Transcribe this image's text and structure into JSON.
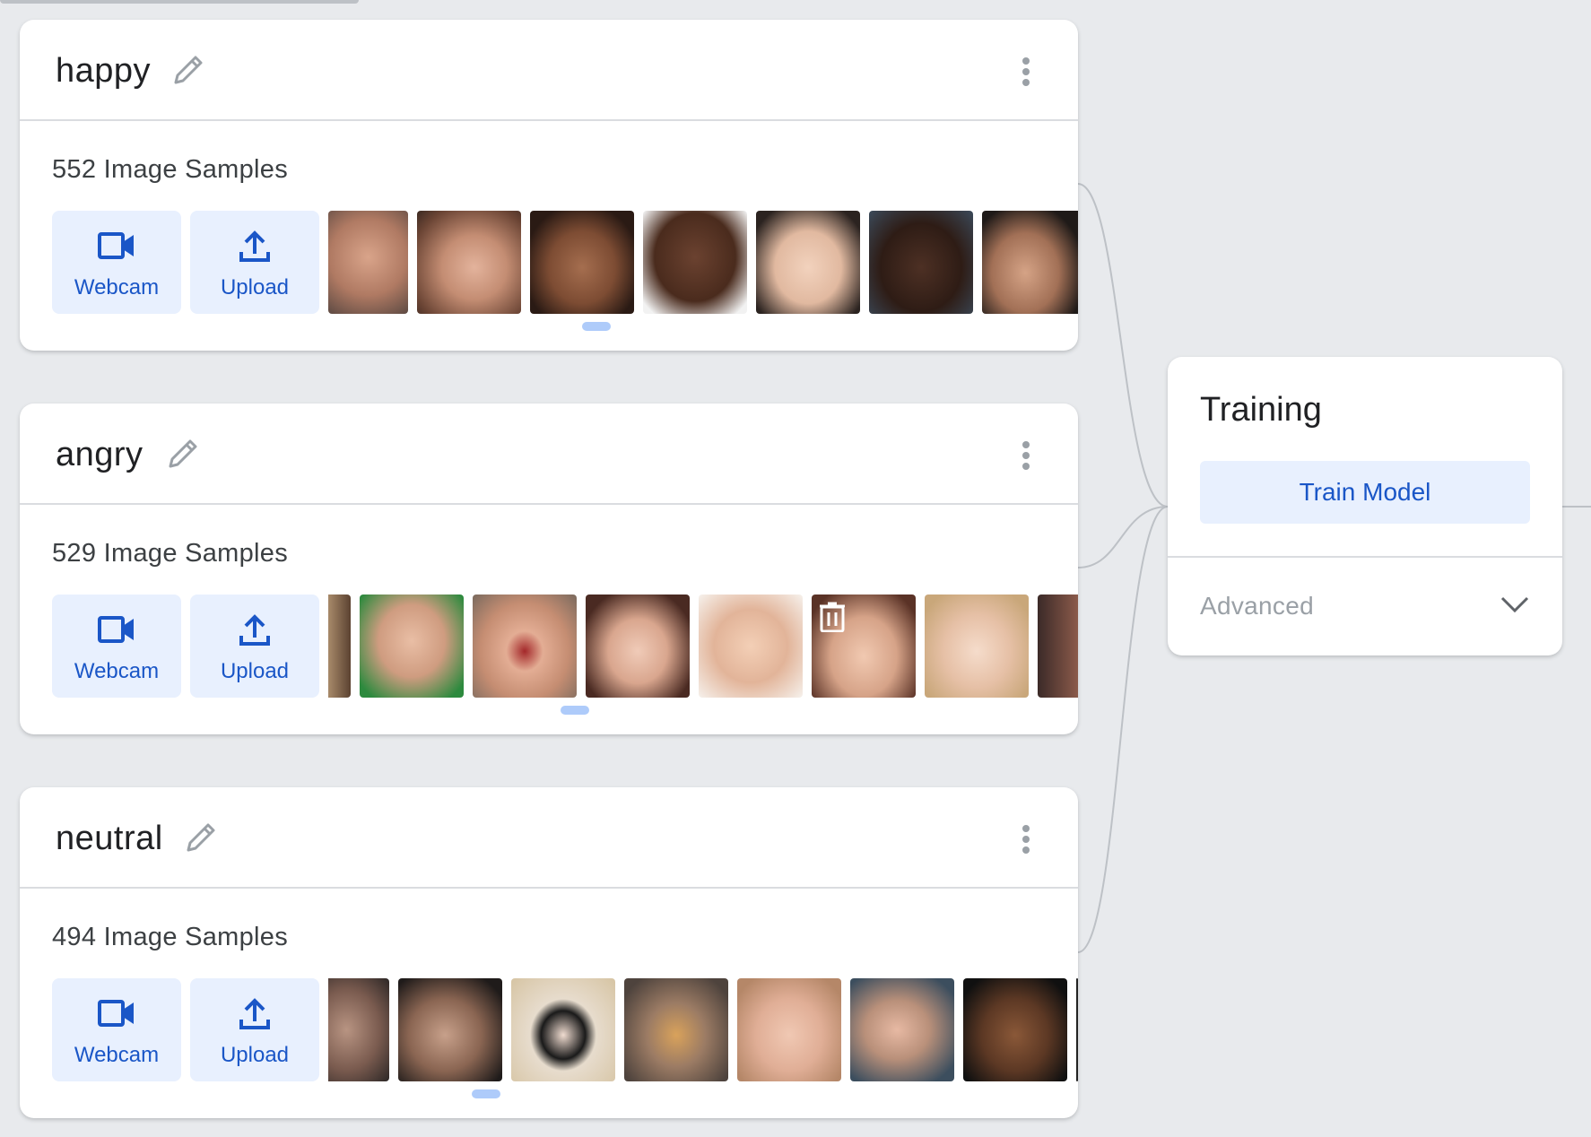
{
  "classes": [
    {
      "name": "happy",
      "sample_count": "552 Image Samples",
      "webcam_label": "Webcam",
      "upload_label": "Upload",
      "thumbnails": [
        "face-1",
        "face-2",
        "face-3",
        "face-4",
        "face-5",
        "face-6",
        "face-7"
      ]
    },
    {
      "name": "angry",
      "sample_count": "529 Image Samples",
      "webcam_label": "Webcam",
      "upload_label": "Upload",
      "thumbnails": [
        "face-1",
        "face-2",
        "face-3",
        "face-4",
        "face-5",
        "face-6",
        "face-7",
        "face-8"
      ]
    },
    {
      "name": "neutral",
      "sample_count": "494 Image Samples",
      "webcam_label": "Webcam",
      "upload_label": "Upload",
      "thumbnails": [
        "face-1",
        "face-2",
        "face-3",
        "face-4",
        "face-5",
        "face-6",
        "face-7",
        "face-8"
      ]
    }
  ],
  "training": {
    "title": "Training",
    "train_button": "Train Model",
    "advanced_label": "Advanced"
  },
  "icons": {
    "edit": "pencil-icon",
    "menu": "more-vert-icon",
    "webcam": "videocam-icon",
    "upload": "upload-icon",
    "advanced_toggle": "chevron-down-icon",
    "delete": "trash-icon"
  },
  "colors": {
    "background": "#e8eaed",
    "accent": "#1a56c7",
    "button_bg": "#e8f0fe",
    "scroll_indicator": "#aecbfa"
  }
}
